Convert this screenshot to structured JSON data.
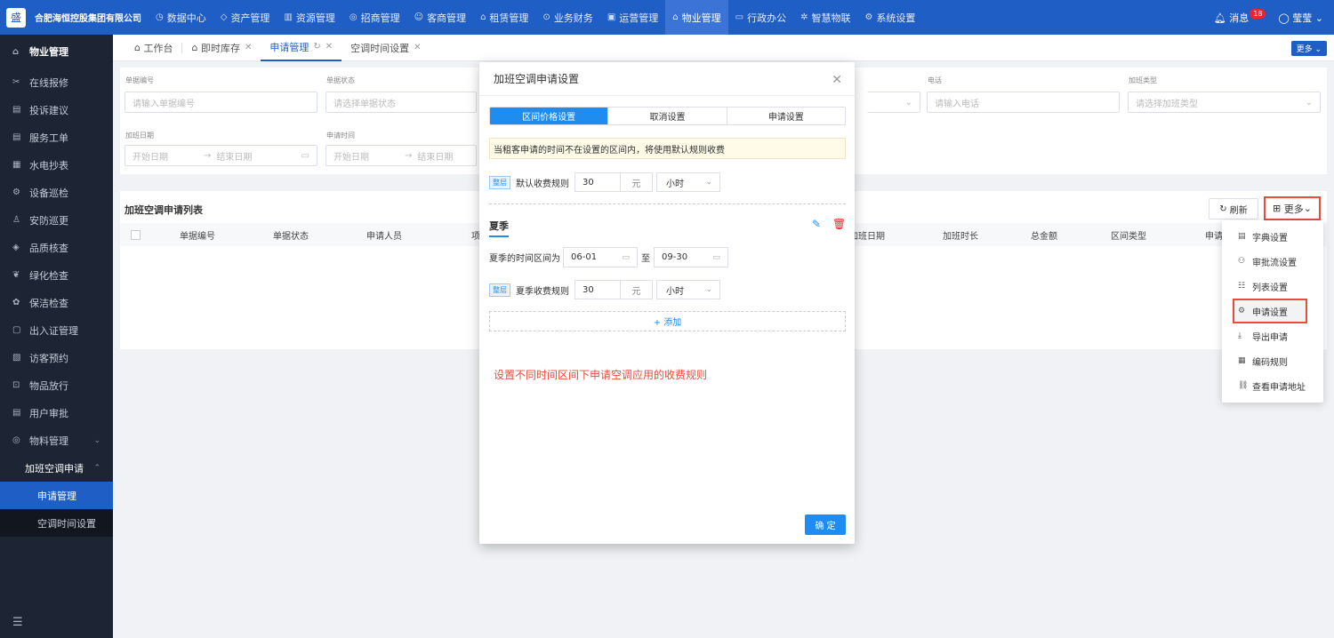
{
  "topnav": {
    "logo_glyph": "盛",
    "company": "合肥海恒控股集团有限公司",
    "items": [
      {
        "icon": "dashboard-icon",
        "label": "数据中心"
      },
      {
        "icon": "cube-icon",
        "label": "资产管理"
      },
      {
        "icon": "building-icon",
        "label": "资源管理"
      },
      {
        "icon": "tag-icon",
        "label": "招商管理"
      },
      {
        "icon": "customers-icon",
        "label": "客商管理"
      },
      {
        "icon": "house-icon",
        "label": "租赁管理"
      },
      {
        "icon": "coin-icon",
        "label": "业务财务"
      },
      {
        "icon": "chart-icon",
        "label": "运营管理"
      },
      {
        "icon": "home-icon",
        "label": "物业管理"
      },
      {
        "icon": "monitor-icon",
        "label": "行政办公"
      },
      {
        "icon": "network-icon",
        "label": "智慧物联"
      },
      {
        "icon": "gear-icon",
        "label": "系统设置"
      }
    ],
    "active_index": 8,
    "messages_label": "消息",
    "messages_count": "18",
    "user_name": "莹莹"
  },
  "sidebar": {
    "header": "物业管理",
    "items": [
      {
        "icon": "wrench-icon",
        "label": "在线报修"
      },
      {
        "icon": "doc-icon",
        "label": "投诉建议"
      },
      {
        "icon": "doc-icon",
        "label": "服务工单"
      },
      {
        "icon": "meter-icon",
        "label": "水电抄表"
      },
      {
        "icon": "gear-icon",
        "label": "设备巡检"
      },
      {
        "icon": "guard-icon",
        "label": "安防巡更"
      },
      {
        "icon": "shield-icon",
        "label": "品质核查"
      },
      {
        "icon": "leaf-icon",
        "label": "绿化检查"
      },
      {
        "icon": "clean-icon",
        "label": "保洁检查"
      },
      {
        "icon": "card-icon",
        "label": "出入证管理"
      },
      {
        "icon": "visitor-icon",
        "label": "访客预约"
      },
      {
        "icon": "box-icon",
        "label": "物品放行"
      },
      {
        "icon": "user-check-icon",
        "label": "用户审批"
      },
      {
        "icon": "material-icon",
        "label": "物料管理"
      }
    ],
    "group": "加班空调申请",
    "subitems": [
      {
        "label": "申请管理",
        "active": true
      },
      {
        "label": "空调时间设置",
        "active": false
      }
    ]
  },
  "tabs": {
    "items": [
      {
        "label": "工作台",
        "icon": "workbench-icon",
        "closable": false
      },
      {
        "label": "即时库存",
        "icon": "home-icon",
        "closable": true
      },
      {
        "label": "申请管理",
        "active": true,
        "closable": true
      },
      {
        "label": "空调时间设置",
        "closable": true
      }
    ],
    "more_label": "更多"
  },
  "filters": {
    "fields": [
      {
        "label": "单据编号",
        "placeholder": "请输入单据编号"
      },
      {
        "label": "单据状态",
        "placeholder": "请选择单据状态"
      },
      {
        "label": "电话",
        "placeholder": "请输入电话"
      },
      {
        "label": "加班类型",
        "placeholder": "请选择加班类型"
      },
      {
        "label": "加班日期",
        "start": "开始日期",
        "end": "结束日期"
      },
      {
        "label": "申请时间",
        "start": "开始日期",
        "end": "结束日期"
      }
    ]
  },
  "list": {
    "title": "加班空调申请列表",
    "refresh_label": "刷新",
    "more_label": "更多",
    "columns": [
      "单据编号",
      "单据状态",
      "申请人员",
      "项",
      "加班日期",
      "加班时长",
      "总金额",
      "区间类型",
      "申请"
    ]
  },
  "dropdown": {
    "items": [
      {
        "icon": "dict-icon",
        "label": "字典设置"
      },
      {
        "icon": "workflow-icon",
        "label": "审批流设置"
      },
      {
        "icon": "list-icon",
        "label": "列表设置"
      },
      {
        "icon": "gear-icon",
        "label": "申请设置",
        "highlighted": true
      },
      {
        "icon": "download-icon",
        "label": "导出申请"
      },
      {
        "icon": "code-icon",
        "label": "编码规则"
      },
      {
        "icon": "link-icon",
        "label": "查看申请地址"
      }
    ]
  },
  "modal": {
    "title": "加班空调申请设置",
    "segments": [
      "区间价格设置",
      "取消设置",
      "申请设置"
    ],
    "active_segment": 0,
    "notice": "当租客申请的时间不在设置的区间内，将使用默认规则收费",
    "default_rule": {
      "tag": "整层",
      "label": "默认收费规则",
      "value": "30",
      "unit": "元",
      "period": "小时"
    },
    "season": {
      "name": "夏季",
      "range_label": "夏季的时间区间为",
      "start": "06-01",
      "to": "至",
      "end": "09-30",
      "rule": {
        "tag": "整层",
        "label": "夏季收费规则",
        "value": "30",
        "unit": "元",
        "period": "小时"
      }
    },
    "add_label": "+ 添加",
    "annotation": "设置不同时间区间下申请空调应用的收费规则",
    "confirm_label": "确 定"
  }
}
